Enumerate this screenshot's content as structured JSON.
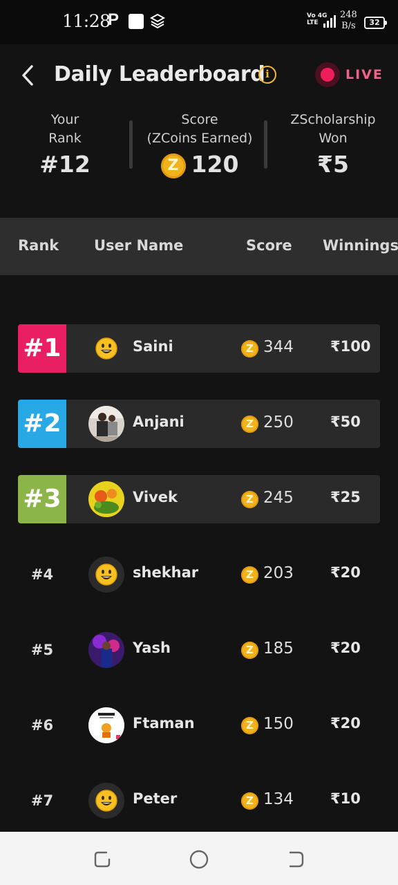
{
  "status_bar": {
    "time": "11:28",
    "network_top": "Vo 4G",
    "network_bottom": "LTE",
    "speed_value": "248",
    "speed_unit": "B/s",
    "battery": "32"
  },
  "header": {
    "title": "Daily Leaderboard",
    "live_label": "LIVE"
  },
  "stats": {
    "rank_label_1": "Your",
    "rank_label_2": "Rank",
    "rank_value": "#12",
    "score_label_1": "Score",
    "score_label_2": "(ZCoins Earned)",
    "score_value": "120",
    "won_label_1": "ZScholarship",
    "won_label_2": "Won",
    "won_value": "₹5"
  },
  "table": {
    "col_rank": "Rank",
    "col_user": "User Name",
    "col_score": "Score",
    "col_winnings": "Winnings",
    "rows": [
      {
        "rank": "#1",
        "name": "Saini",
        "score": "344",
        "winnings": "₹100",
        "avatar": "smiley-emoji"
      },
      {
        "rank": "#2",
        "name": "Anjani",
        "score": "250",
        "winnings": "₹50",
        "avatar": "photo"
      },
      {
        "rank": "#3",
        "name": "Vivek",
        "score": "245",
        "winnings": "₹25",
        "avatar": "photo"
      },
      {
        "rank": "#4",
        "name": "shekhar",
        "score": "203",
        "winnings": "₹20",
        "avatar": "smiley-emoji"
      },
      {
        "rank": "#5",
        "name": "Yash",
        "score": "185",
        "winnings": "₹20",
        "avatar": "photo"
      },
      {
        "rank": "#6",
        "name": "Ftaman",
        "score": "150",
        "winnings": "₹20",
        "avatar": "photo"
      },
      {
        "rank": "#7",
        "name": "Peter",
        "score": "134",
        "winnings": "₹10",
        "avatar": "smiley-emoji"
      }
    ]
  },
  "colors": {
    "rank1": "#e91e63",
    "rank2": "#29a8e6",
    "rank3": "#8bb548",
    "coin": "#f2b21c",
    "live": "#ee1e5b"
  },
  "coin_letter": "Z",
  "info_glyph": "i"
}
